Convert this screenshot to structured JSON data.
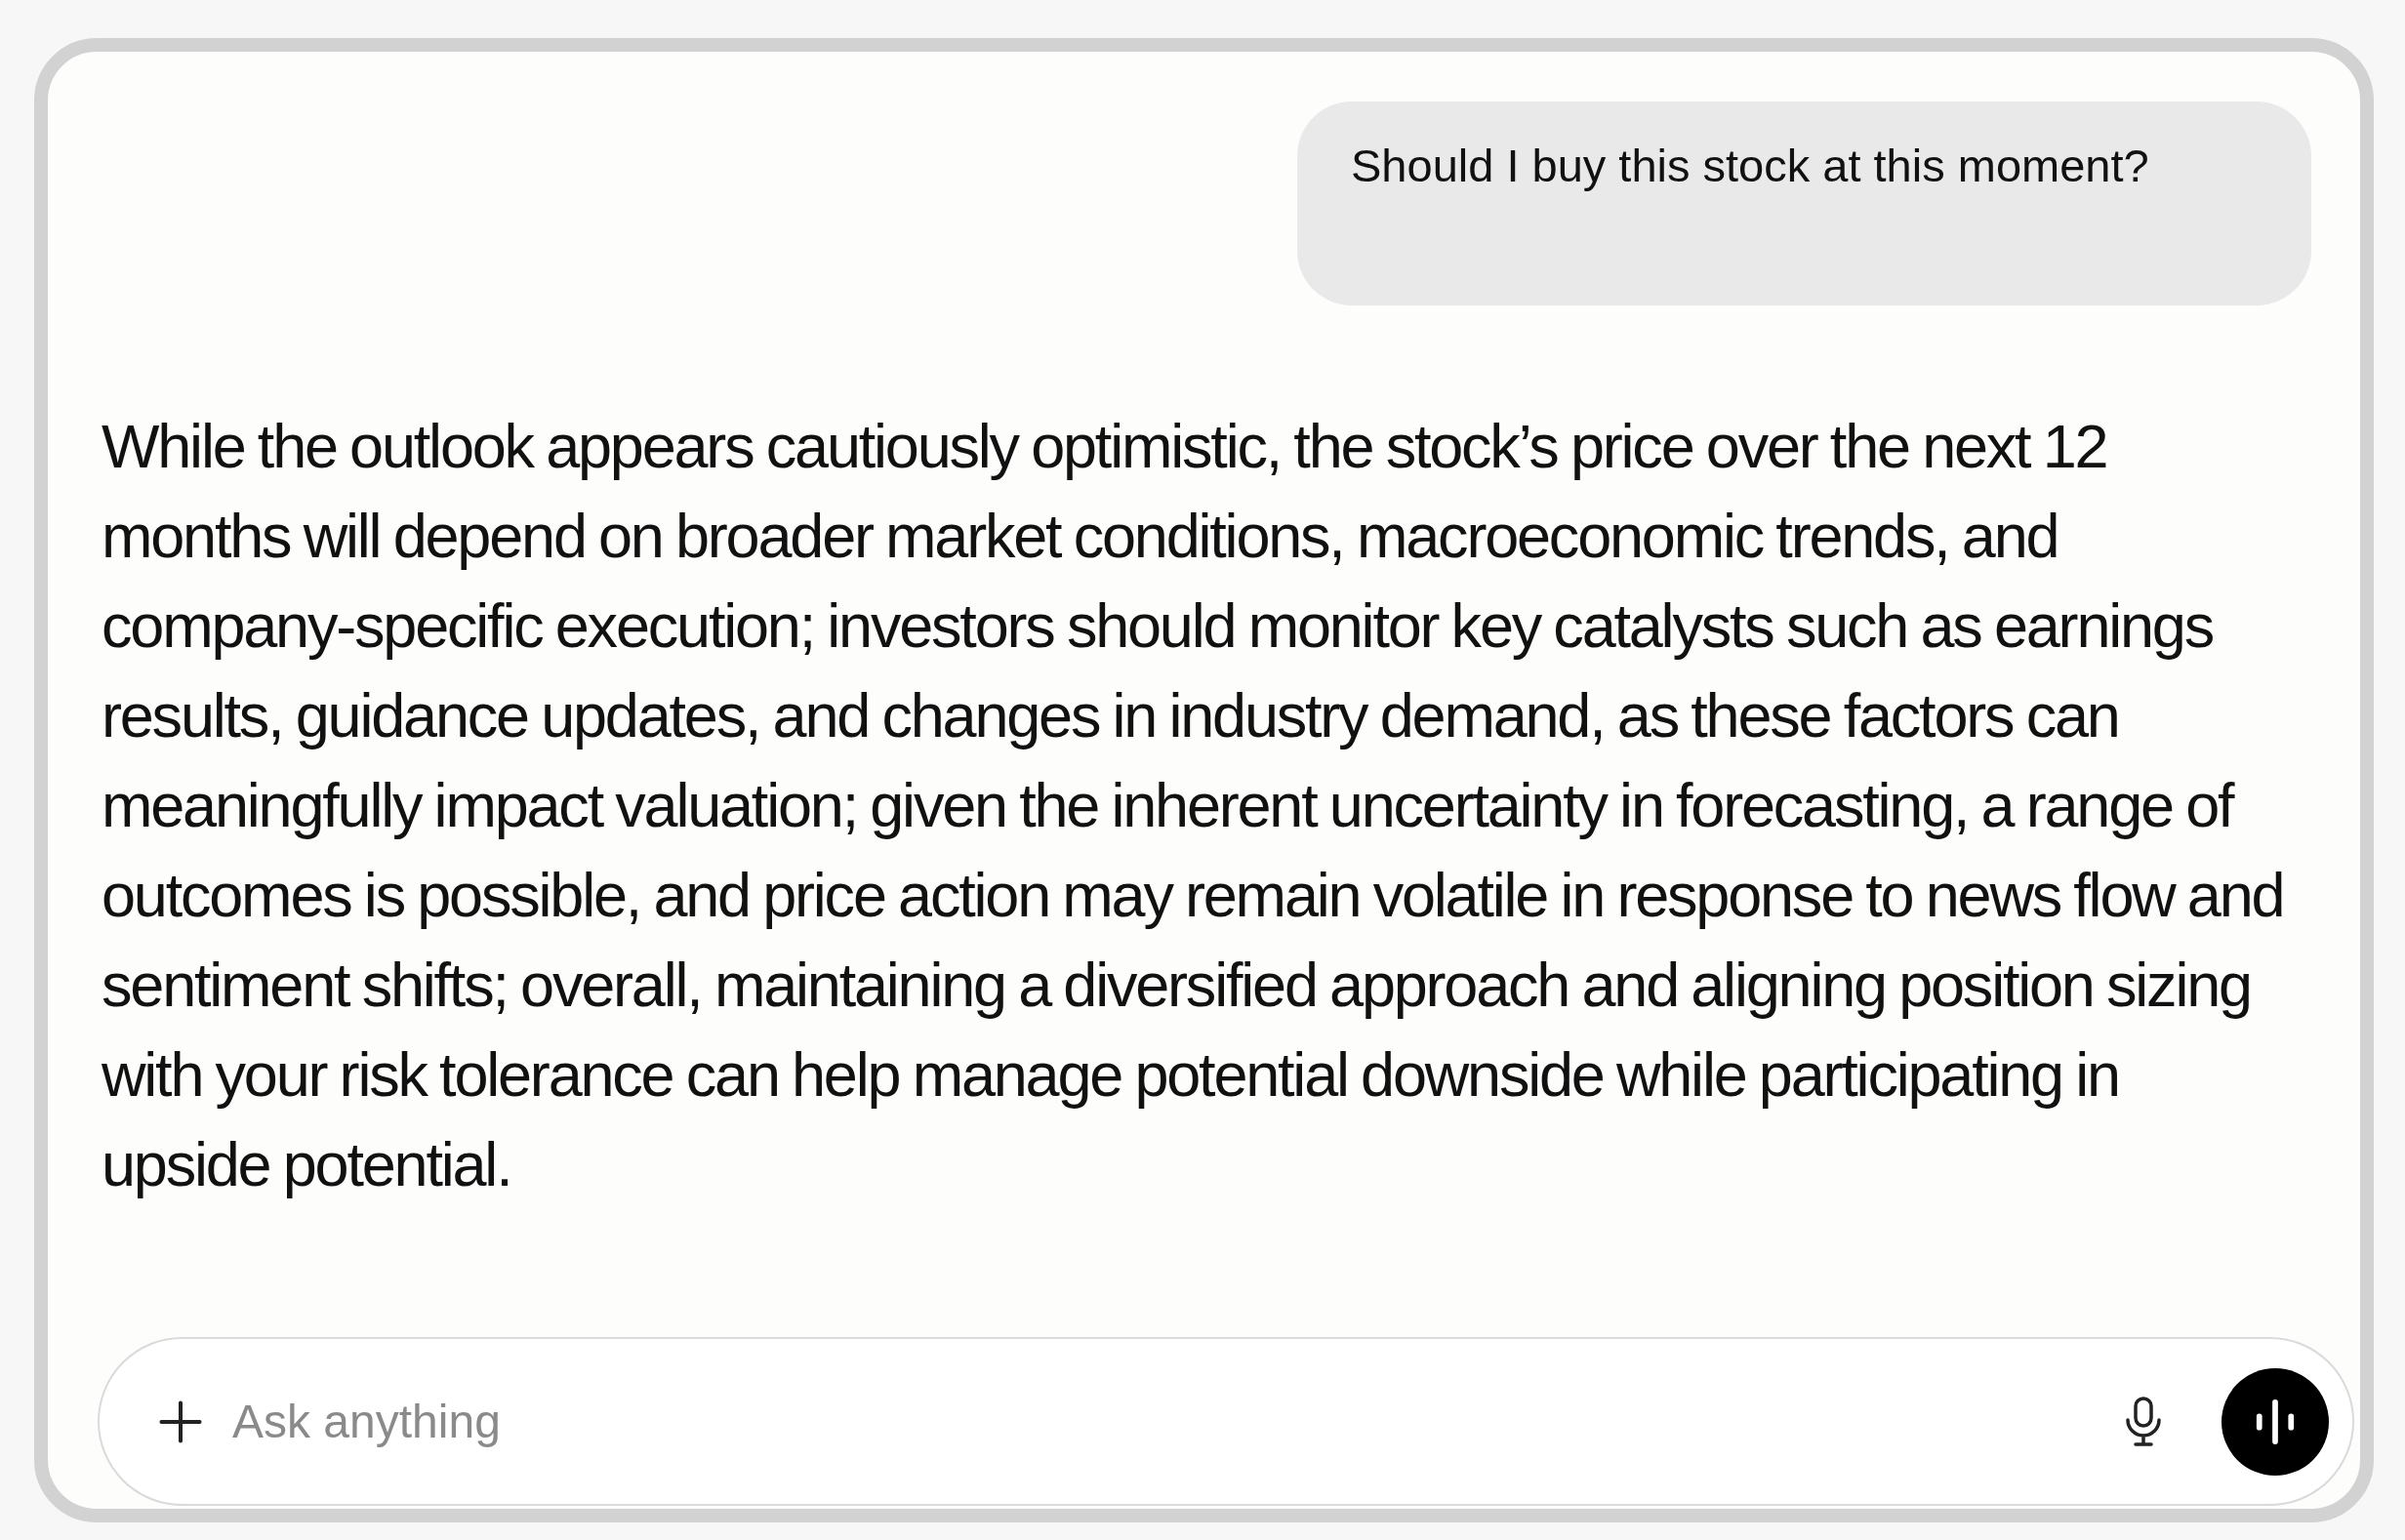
{
  "messages": [
    {
      "kind": "user",
      "text": "Should I buy this stock at this moment?"
    },
    {
      "kind": "assistant",
      "text": "While the outlook appears cautiously optimistic, the stock’s price over the next 12 months will depend on broader market conditions, macroeconomic trends, and company-specific execution; investors should monitor key catalysts such as earnings results, guidance updates, and changes in industry demand, as these factors can meaningfully impact valuation; given the inherent uncertainty in forecasting, a range of outcomes is possible, and price action may remain volatile in response to news flow and sentiment shifts; overall, maintaining a diversified approach and aligning position sizing with your risk tolerance can help manage potential downside while participating in upside potential."
    }
  ],
  "composer": {
    "placeholder": "Ask anything"
  }
}
